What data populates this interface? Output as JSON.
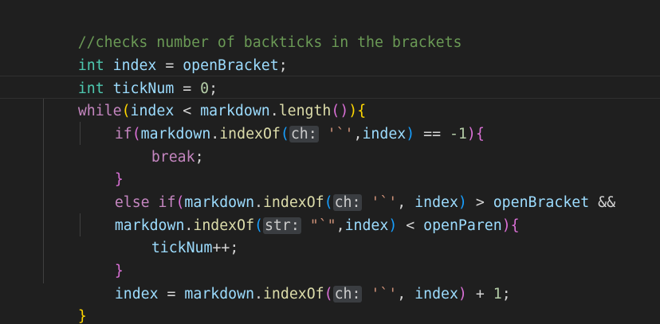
{
  "code": {
    "lines": [
      {
        "indent": "  ",
        "comment": "//checks number of backticks in the brackets"
      },
      {
        "indent": "  ",
        "type": "int",
        "var": "index",
        "op": " = ",
        "ref": "openBracket",
        "end": ";"
      },
      {
        "indent": "  ",
        "type": "int",
        "var": "tickNum",
        "op": " = ",
        "num": "0",
        "end": ";"
      },
      {
        "indent": "  ",
        "kw": "while",
        "open": "(",
        "var": "index",
        "op": " < ",
        "obj": "markdown",
        "dot": ".",
        "fn": "length",
        "call": "()",
        "close": ")",
        "brace": "{"
      },
      {
        "indent": "    ",
        "kw": "if",
        "open": "(",
        "obj": "markdown",
        "dot": ".",
        "fn": "indexOf",
        "p_open": "(",
        "hint": "ch:",
        "str": " '`'",
        "sep": ",",
        "arg": "index",
        "p_close": ")",
        "op": " == ",
        "num": "-1",
        "close": ")",
        "brace": "{"
      },
      {
        "indent": "      ",
        "kw": "break",
        "end": ";"
      },
      {
        "indent": "    ",
        "brace": "}"
      },
      {
        "indent": "    ",
        "kw": "else if",
        "open": "(",
        "obj": "markdown",
        "dot": ".",
        "fn": "indexOf",
        "p_open": "(",
        "hint": "ch:",
        "str": " '`'",
        "sep": ", ",
        "arg": "index",
        "p_close": ")",
        "op": " > ",
        "ref": "openBracket",
        "tail": " &&"
      },
      {
        "indent": "    ",
        "obj": "markdown",
        "dot": ".",
        "fn": "indexOf",
        "p_open": "(",
        "hint": "str:",
        "str": " \"`\"",
        "sep": ",",
        "arg": "index",
        "p_close": ")",
        "op": " < ",
        "ref": "openParen",
        "close": ")",
        "brace": "{"
      },
      {
        "indent": "      ",
        "var": "tickNum",
        "op": "++",
        "end": ";"
      },
      {
        "indent": "    ",
        "brace": "}"
      },
      {
        "indent": "    ",
        "var": "index",
        "op": " = ",
        "obj": "markdown",
        "dot": ".",
        "fn": "indexOf",
        "p_open": "(",
        "hint": "ch:",
        "str": " '`'",
        "sep": ", ",
        "arg": "index",
        "p_close": ")",
        "op2": " + ",
        "num": "1",
        "end": ";"
      },
      {
        "indent": "  ",
        "brace": "}"
      }
    ]
  }
}
